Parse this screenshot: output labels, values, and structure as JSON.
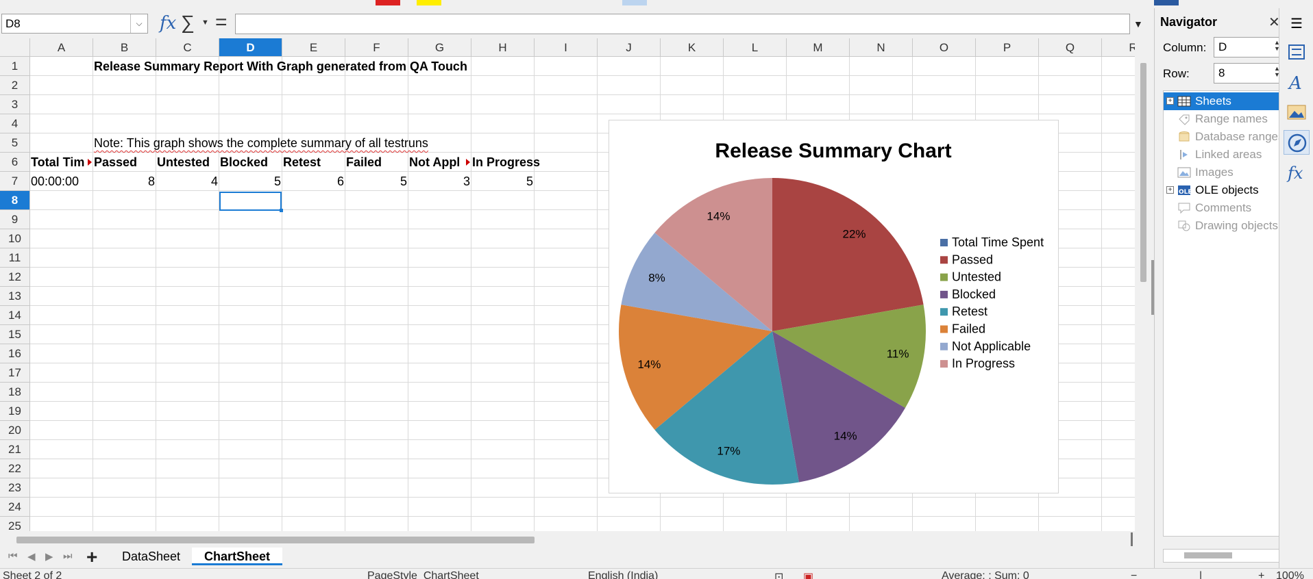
{
  "formula_bar": {
    "name_box": "D8",
    "formula": ""
  },
  "columns": [
    "A",
    "B",
    "C",
    "D",
    "E",
    "F",
    "G",
    "H",
    "I",
    "J",
    "K",
    "L",
    "M",
    "N",
    "O",
    "P",
    "Q",
    "R"
  ],
  "selected_column": "D",
  "rows": [
    "1",
    "2",
    "3",
    "4",
    "5",
    "6",
    "7",
    "8",
    "9",
    "10",
    "11",
    "12",
    "13",
    "14",
    "15",
    "16",
    "17",
    "18",
    "19",
    "20",
    "21",
    "22",
    "23",
    "24",
    "25"
  ],
  "selected_row": "8",
  "cells": {
    "B1": "Release Summary Report With Graph generated from QA Touch",
    "B3": "Note: This graph shows the complete summary of all testruns",
    "A6": "Total Tim",
    "B6": "Passed",
    "C6": "Untested",
    "D6": "Blocked",
    "E6": "Retest",
    "F6": "Failed",
    "G6": "Not Appl",
    "H6": "In Progress",
    "A7": "00:00:00",
    "B7": "8",
    "C7": "4",
    "D7": "5",
    "E7": "6",
    "F7": "5",
    "G7": "3",
    "H7": "5"
  },
  "chart_data": {
    "type": "pie",
    "title": "Release Summary Chart",
    "categories": [
      "Total Time Spent",
      "Passed",
      "Untested",
      "Blocked",
      "Retest",
      "Failed",
      "Not Applicable",
      "In Progress"
    ],
    "values": [
      0,
      8,
      4,
      5,
      6,
      5,
      3,
      5
    ],
    "labels": [
      "",
      "22%",
      "11%",
      "14%",
      "17%",
      "14%",
      "8%",
      "14%"
    ],
    "colors": [
      "#4a6fa5",
      "#a94442",
      "#89a34a",
      "#71558a",
      "#3f97ad",
      "#db8239",
      "#93a8cf",
      "#cd9090"
    ],
    "legend_position": "right"
  },
  "sheet_tabs": [
    "DataSheet",
    "ChartSheet"
  ],
  "active_sheet": "ChartSheet",
  "statusbar": {
    "sheet_pos": "Sheet 2 of 2",
    "page_style": "PageStyle_ChartSheet",
    "language": "English (India)",
    "sum": "Average: ; Sum: 0",
    "zoom": "100%"
  },
  "navigator": {
    "title": "Navigator",
    "column_label": "Column:",
    "column_value": "D",
    "row_label": "Row:",
    "row_value": "8",
    "items": [
      {
        "label": "Sheets",
        "state": "selected",
        "expand": true,
        "icon": "sheets-icon"
      },
      {
        "label": "Range names",
        "state": "dim",
        "expand": false,
        "icon": "range-names-icon"
      },
      {
        "label": "Database ranges",
        "state": "dim",
        "expand": false,
        "icon": "database-icon"
      },
      {
        "label": "Linked areas",
        "state": "dim",
        "expand": false,
        "icon": "linked-areas-icon"
      },
      {
        "label": "Images",
        "state": "dim",
        "expand": false,
        "icon": "images-icon"
      },
      {
        "label": "OLE objects",
        "state": "normal",
        "expand": true,
        "icon": "ole-icon"
      },
      {
        "label": "Comments",
        "state": "dim",
        "expand": false,
        "icon": "comments-icon"
      },
      {
        "label": "Drawing objects",
        "state": "dim",
        "expand": false,
        "icon": "drawing-icon"
      }
    ]
  }
}
